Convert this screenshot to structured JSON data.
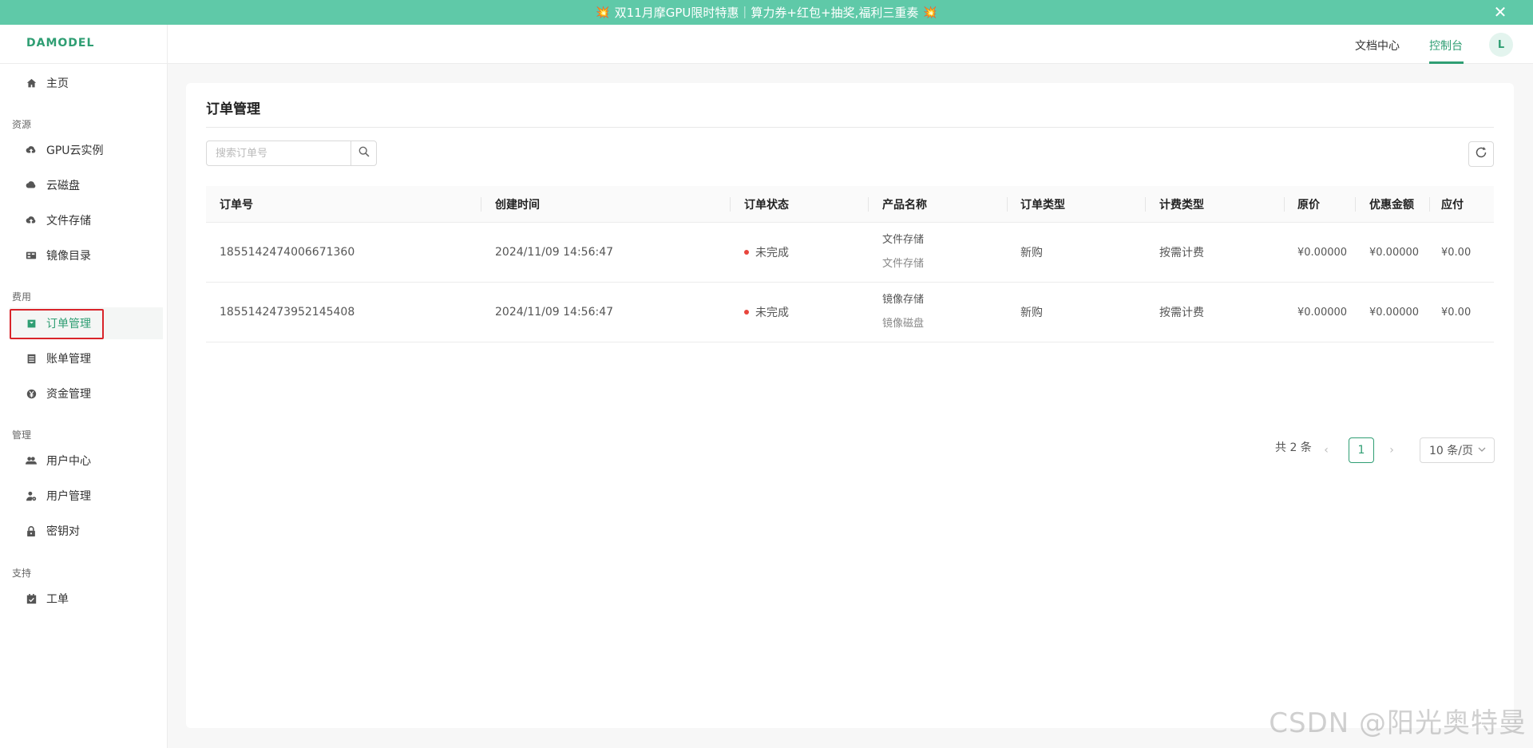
{
  "banner": {
    "emoji": "💥",
    "text": "双11月摩GPU限时特惠｜算力券+红包+抽奖,福利三重奏",
    "close": "✕"
  },
  "header": {
    "logo": "DAMODEL",
    "nav_docs": "文档中心",
    "nav_console": "控制台",
    "avatar_letter": "L"
  },
  "sidebar": {
    "home": "主页",
    "group_resources": "资源",
    "gpu_instances": "GPU云实例",
    "cloud_disk": "云磁盘",
    "file_storage": "文件存储",
    "image_catalog": "镜像目录",
    "group_billing": "费用",
    "order_management": "订单管理",
    "bill_management": "账单管理",
    "fund_management": "资金管理",
    "group_manage": "管理",
    "user_center": "用户中心",
    "user_management": "用户管理",
    "key_pair": "密钥对",
    "group_support": "支持",
    "ticket": "工单"
  },
  "main": {
    "title": "订单管理",
    "search_placeholder": "搜索订单号",
    "columns": [
      "订单号",
      "创建时间",
      "订单状态",
      "产品名称",
      "订单类型",
      "计费类型",
      "原价",
      "优惠金额",
      "应付"
    ],
    "rows": [
      {
        "order_no": "1855142474006671360",
        "created": "2024/11/09 14:56:47",
        "status": "未完成",
        "product": "文件存储",
        "product_sub": "文件存储",
        "order_type": "新购",
        "billing_type": "按需计费",
        "original_price": "¥0.00000",
        "discount": "¥0.00000",
        "payable": "¥0.00"
      },
      {
        "order_no": "1855142473952145408",
        "created": "2024/11/09 14:56:47",
        "status": "未完成",
        "product": "镜像存储",
        "product_sub": "镜像磁盘",
        "order_type": "新购",
        "billing_type": "按需计费",
        "original_price": "¥0.00000",
        "discount": "¥0.00000",
        "payable": "¥0.00"
      }
    ],
    "pagination": {
      "total": "共 2 条",
      "current_page": "1",
      "page_size": "10 条/页"
    }
  },
  "watermark": "CSDN @阳光奥特曼",
  "colors": {
    "accent": "#2f9e73",
    "banner_bg": "#5fc9a8",
    "status_dot": "#e8453c"
  }
}
